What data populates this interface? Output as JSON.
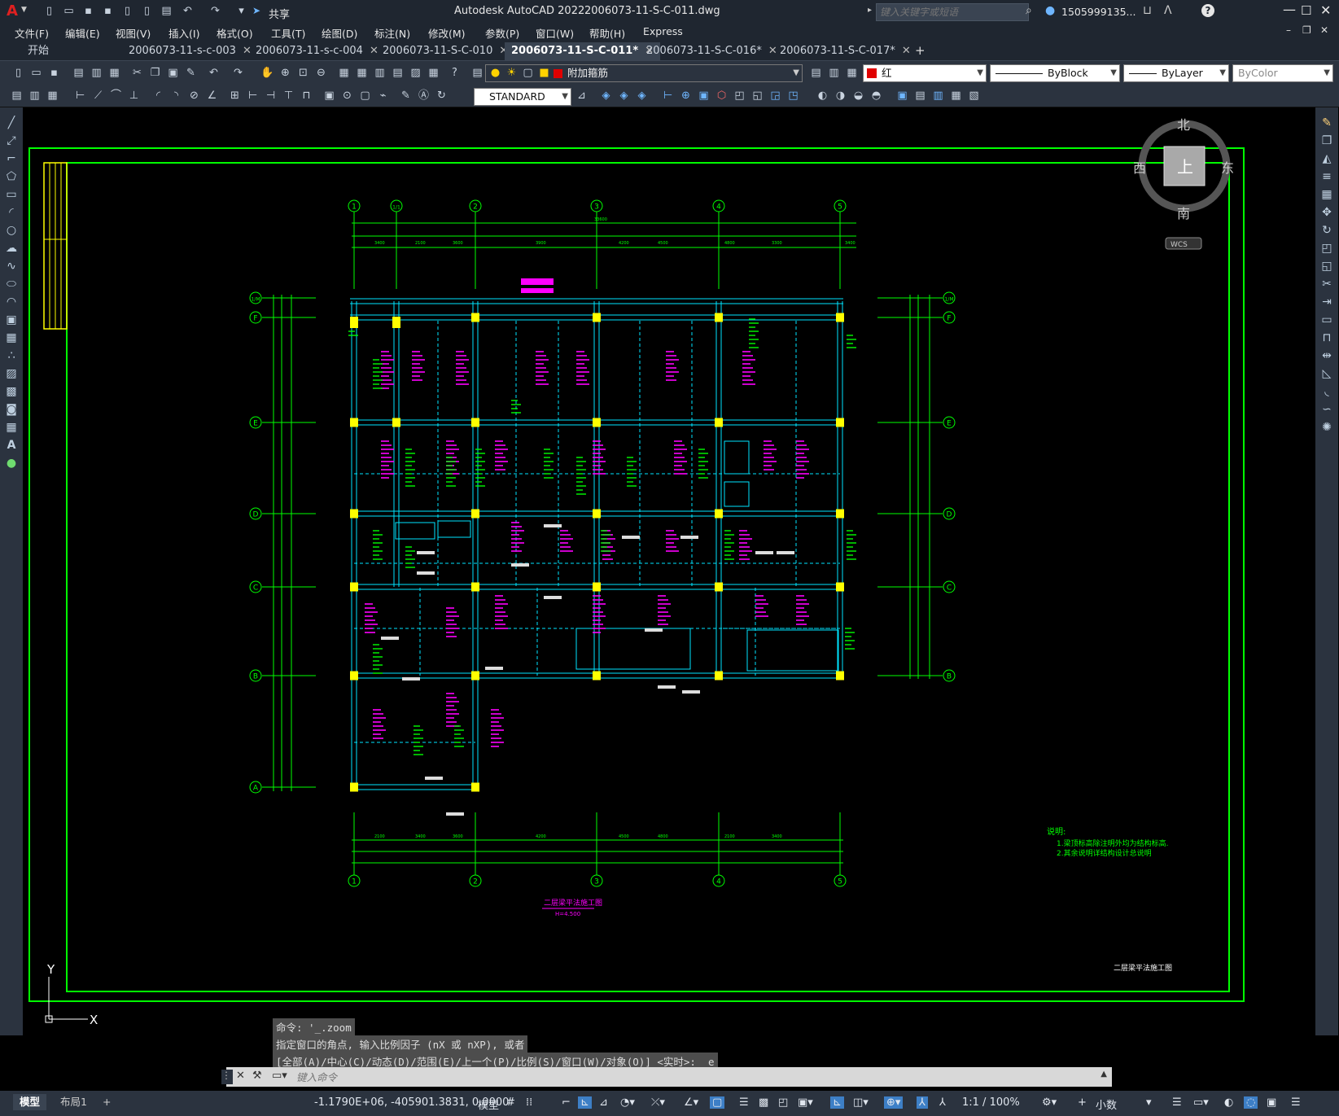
{
  "app": {
    "logo": "A",
    "title": "Autodesk AutoCAD 2022",
    "file_name": "2006073-11-S-C-011.dwg",
    "share_label": "共享",
    "search_placeholder": "键入关键字或短语",
    "user": "1505999135...",
    "help": "?"
  },
  "menu": [
    "文件(F)",
    "编辑(E)",
    "视图(V)",
    "插入(I)",
    "格式(O)",
    "工具(T)",
    "绘图(D)",
    "标注(N)",
    "修改(M)",
    "参数(P)",
    "窗口(W)",
    "帮助(H)",
    "Express"
  ],
  "tabs": [
    {
      "label": "开始"
    },
    {
      "label": "2006073-11-s-c-003"
    },
    {
      "label": "2006073-11-s-c-004"
    },
    {
      "label": "2006073-11-S-C-010"
    },
    {
      "label": "2006073-11-S-C-011*"
    },
    {
      "label": "2006073-11-S-C-016*"
    },
    {
      "label": "2006073-11-S-C-017*"
    }
  ],
  "toolbar": {
    "layer_name": "附加箍筋",
    "color_name": "红",
    "linetype": "ByBlock",
    "lineweight": "ByLayer",
    "plotstyle": "ByColor",
    "textstyle": "STANDARD"
  },
  "viewcube": {
    "north": "北",
    "south": "南",
    "east": "东",
    "west": "西",
    "top": "上",
    "wcs": "WCS"
  },
  "drawing": {
    "grid_top": [
      "1",
      "1/1",
      "2",
      "3",
      "4",
      "5"
    ],
    "grid_bottom": [
      "1",
      "2",
      "3",
      "4",
      "5"
    ],
    "grid_left": [
      "1/M",
      "F",
      "E",
      "D",
      "C",
      "B",
      "A"
    ],
    "grid_right": [
      "1/M",
      "F",
      "E",
      "D",
      "C",
      "B"
    ],
    "dims_top": [
      "3400",
      "2100",
      "3600",
      "3900",
      "4200",
      "4500",
      "4800",
      "3300"
    ],
    "dims_bottom": [
      "2100",
      "3400",
      "3600",
      "4200",
      "4500",
      "4800",
      "33600"
    ],
    "notes_title": "说明:",
    "notes": [
      "1.梁顶标高除注明外均为结构标高.",
      "2.其余说明详结构设计总说明"
    ],
    "plan_title": "二层梁平法施工图",
    "plan_sub": "H=4.500",
    "sheet_label": "二层梁平法施工图",
    "axis_y": "Y",
    "axis_x": "X"
  },
  "command": {
    "history": [
      "命令: '_.zoom",
      "指定窗口的角点, 输入比例因子 (nX 或 nXP), 或者",
      "[全部(A)/中心(C)/动态(D)/范围(E)/上一个(P)/比例(S)/窗口(W)/对象(O)] <实时>: _e"
    ],
    "placeholder": "键入命令"
  },
  "status": {
    "layout_tabs": [
      "模型",
      "布局1"
    ],
    "coords": "-1.1790E+06, -405901.3831, 0.0000",
    "model_label": "模型",
    "scale": "1:1 / 100%",
    "units": "小数"
  },
  "colors": {
    "grid": "#00ff00",
    "beam": "#00e5ff",
    "column": "#ffff00",
    "annotation": "#ff00ff",
    "bg": "#000000",
    "ui": "#2b333f"
  }
}
